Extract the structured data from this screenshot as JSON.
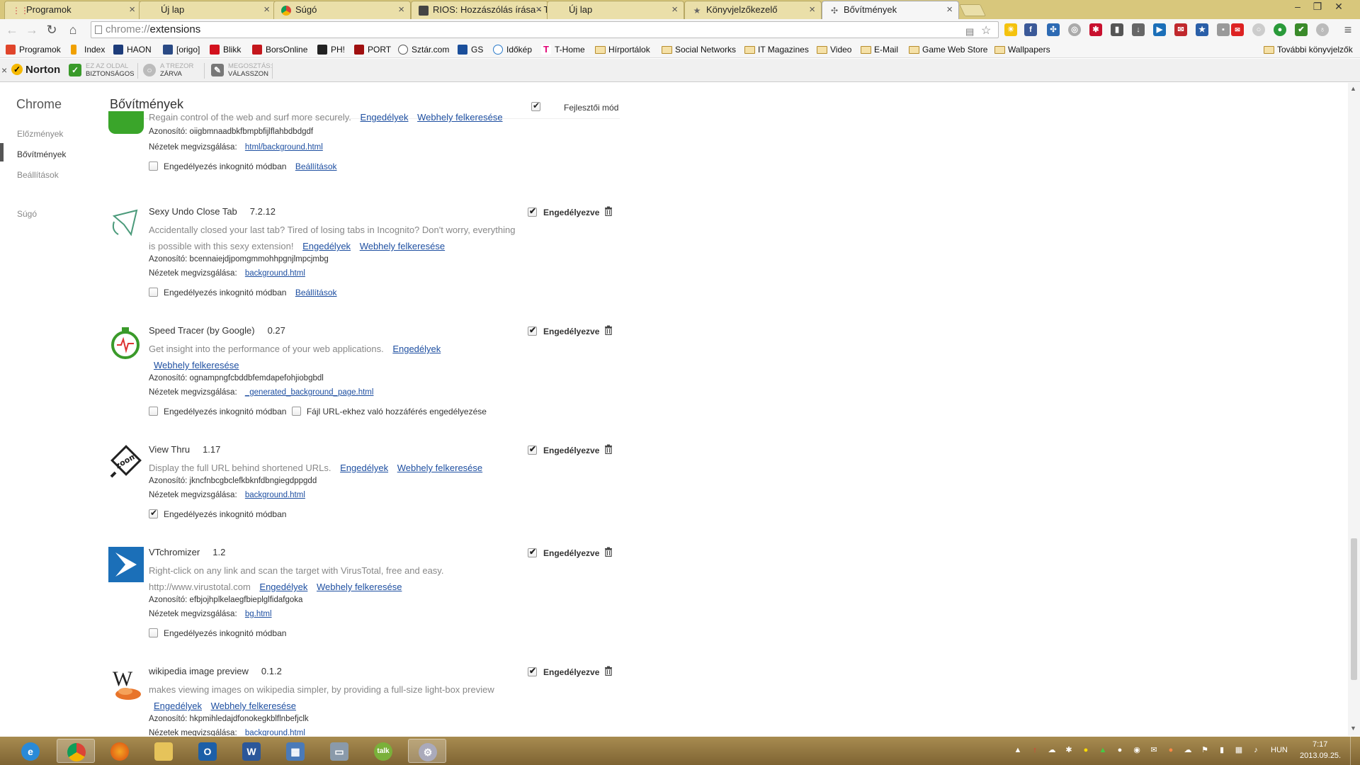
{
  "tabs": [
    {
      "title": "Programok",
      "icon": "apps-grid-icon"
    },
    {
      "title": "Új lap",
      "icon": "blank-page-icon"
    },
    {
      "title": "Súgó",
      "icon": "chrome-icon"
    },
    {
      "title": "RIOS: Hozzászólás írása - T",
      "icon": "rios-icon"
    },
    {
      "title": "Új lap",
      "icon": "blank-page-icon"
    },
    {
      "title": "Könyvjelzőkezelő",
      "icon": "star-icon"
    },
    {
      "title": "Bővítmények",
      "icon": "puzzle-icon"
    }
  ],
  "omnibox": {
    "url_prefix": "chrome://",
    "url_host": "extensions"
  },
  "bookmarks": [
    {
      "label": "Programok",
      "color": "#e0452b"
    },
    {
      "label": "Index",
      "color": "#f0a000"
    },
    {
      "label": "HAON",
      "color": "#1d3c7a"
    },
    {
      "label": "[origo]",
      "color": "#2a4a85"
    },
    {
      "label": "Blikk",
      "color": "#d3111d"
    },
    {
      "label": "BorsOnline",
      "color": "#c4161c"
    },
    {
      "label": "PH!",
      "color": "#222222"
    },
    {
      "label": "PORT",
      "color": "#a01010"
    },
    {
      "label": "Sztár.com",
      "color": "#555555"
    },
    {
      "label": "GS",
      "color": "#1b4f9b"
    },
    {
      "label": "Időkép",
      "color": "#2a7ac9"
    },
    {
      "label": "T-Home",
      "color": "#e20074"
    },
    {
      "label": "Hírportálok",
      "folder": true
    },
    {
      "label": "Social Networks",
      "folder": true
    },
    {
      "label": "IT Magazines",
      "folder": true
    },
    {
      "label": "Video",
      "folder": true
    },
    {
      "label": "E-Mail",
      "folder": true
    },
    {
      "label": "Game Web Store",
      "folder": true
    },
    {
      "label": "Wallpapers",
      "folder": true
    }
  ],
  "more_bookmarks": "További könyvjelzők",
  "norton": {
    "brand": "Norton",
    "safe_line1": "EZ AZ OLDAL",
    "safe_line2": "BIZTONSÁGOS",
    "vault_line1": "A TREZOR",
    "vault_line2": "ZÁRVA",
    "share_line1": "MEGOSZTÁS:",
    "share_line2": "VÁLASSZON"
  },
  "sidebar": {
    "title": "Chrome",
    "links": [
      "Előzmények",
      "Bővítmények",
      "Beállítások"
    ],
    "help": "Súgó"
  },
  "page": {
    "title": "Bővítmények",
    "dev_mode": "Fejlesztői mód"
  },
  "labels": {
    "enabled": "Engedélyezve",
    "permissions": "Engedélyek",
    "visit_site": "Webhely felkeresése",
    "id": "Azonosító:",
    "inspect": "Nézetek megvizsgálása:",
    "incognito": "Engedélyezés inkognitó módban",
    "settings": "Beállítások",
    "file_access": "Fájl URL-ekhez való hozzáférés engedélyezése"
  },
  "extensions": [
    {
      "name": "",
      "version": "",
      "desc": "Regain control of the web and surf more securely.",
      "id": "oiigbmnaadbkfbmpbfijlflahbdbdgdf",
      "view": "html/background.html",
      "incognito": false,
      "has_settings": true
    },
    {
      "name": "Sexy Undo Close Tab",
      "version": "7.2.12",
      "desc": "Accidentally closed your last tab? Tired of losing tabs in Incognito? Don't worry, everything is possible with this sexy extension!",
      "id": "bcennaiejdjpomgmmohhpgnjlmpcjmbg",
      "view": "background.html",
      "incognito": false,
      "has_settings": true,
      "enabled": true
    },
    {
      "name": "Speed Tracer (by Google)",
      "version": "0.27",
      "desc": "Get insight into the performance of your web applications.",
      "id": "ognampngfcbddbfemdapefohjiobgbdl",
      "view": "_generated_background_page.html",
      "incognito": false,
      "file_access": false,
      "enabled": true
    },
    {
      "name": "View Thru",
      "version": "1.17",
      "desc": "Display the full URL behind shortened URLs.",
      "id": "jkncfnbcgbclefkbknfdbngiegdppgdd",
      "view": "background.html",
      "incognito": true,
      "enabled": true
    },
    {
      "name": "VTchromizer",
      "version": "1.2",
      "desc": "Right-click on any link and scan the target with VirusTotal, free and easy.",
      "desc2": "http://www.virustotal.com",
      "id": "efbjojhplkelaegfbieplglfidafgoka",
      "view": "bg.html",
      "incognito": false,
      "enabled": true
    },
    {
      "name": "wikipedia image preview",
      "version": "0.1.2",
      "desc": "makes viewing images on wikipedia simpler, by providing a full-size light-box preview",
      "id": "hkpmihledajdfonokegkblflnbefjclk",
      "view": "background.html",
      "enabled": true
    }
  ],
  "taskbar": {
    "lang": "HUN",
    "time": "7:17",
    "date": "2013.09.25."
  },
  "colors": {
    "tabstrip": "#d8c77c",
    "link": "#1e4fa1",
    "taskbar": "#8c7240"
  }
}
